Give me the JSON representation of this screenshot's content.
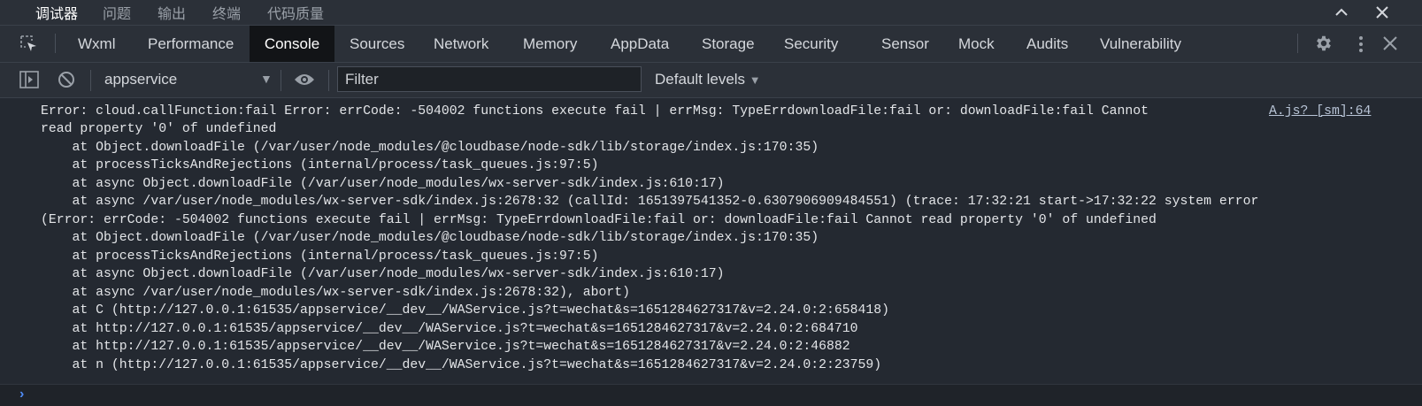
{
  "top_tabs": [
    "调试器",
    "问题",
    "输出",
    "终端",
    "代码质量"
  ],
  "devtools_tabs": [
    "Wxml",
    "Performance",
    "Console",
    "Sources",
    "Network",
    "Memory",
    "AppData",
    "Storage",
    "Security",
    "Sensor",
    "Mock",
    "Audits",
    "Vulnerability"
  ],
  "active_tab": "Console",
  "toolbar": {
    "context": "appservice",
    "filter_placeholder": "Filter",
    "levels": "Default levels"
  },
  "console": {
    "source_link": "A.js? [sm]:64",
    "lines": [
      "Error: cloud.callFunction:fail Error: errCode: -504002 functions execute fail | errMsg: TypeErrdownloadFile:fail or: downloadFile:fail Cannot",
      "read property '0' of undefined",
      "    at Object.downloadFile (/var/user/node_modules/@cloudbase/node-sdk/lib/storage/index.js:170:35)",
      "    at processTicksAndRejections (internal/process/task_queues.js:97:5)",
      "    at async Object.downloadFile (/var/user/node_modules/wx-server-sdk/index.js:610:17)",
      "    at async /var/user/node_modules/wx-server-sdk/index.js:2678:32 (callId: 1651397541352-0.6307906909484551) (trace: 17:32:21 start->17:32:22 system error",
      "(Error: errCode: -504002 functions execute fail | errMsg: TypeErrdownloadFile:fail or: downloadFile:fail Cannot read property '0' of undefined",
      "    at Object.downloadFile (/var/user/node_modules/@cloudbase/node-sdk/lib/storage/index.js:170:35)",
      "    at processTicksAndRejections (internal/process/task_queues.js:97:5)",
      "    at async Object.downloadFile (/var/user/node_modules/wx-server-sdk/index.js:610:17)",
      "    at async /var/user/node_modules/wx-server-sdk/index.js:2678:32), abort)",
      "    at C (http://127.0.0.1:61535/appservice/__dev__/WAService.js?t=wechat&s=1651284627317&v=2.24.0:2:658418)",
      "    at http://127.0.0.1:61535/appservice/__dev__/WAService.js?t=wechat&s=1651284627317&v=2.24.0:2:684710",
      "    at http://127.0.0.1:61535/appservice/__dev__/WAService.js?t=wechat&s=1651284627317&v=2.24.0:2:46882",
      "    at n (http://127.0.0.1:61535/appservice/__dev__/WAService.js?t=wechat&s=1651284627317&v=2.24.0:2:23759)"
    ]
  },
  "icons": {
    "collapse": "chevron-up-icon",
    "close": "close-icon",
    "settings": "gear-icon",
    "more": "more-vertical-icon",
    "inspect": "inspect-element-icon",
    "sidebar": "sidebar-toggle-icon",
    "clear": "clear-console-icon",
    "live_expression": "eye-icon"
  },
  "colors": {
    "background": "#242931",
    "toolbar": "#2b3038",
    "active_tab": "#121417",
    "prompt": "#4f8cf7"
  }
}
